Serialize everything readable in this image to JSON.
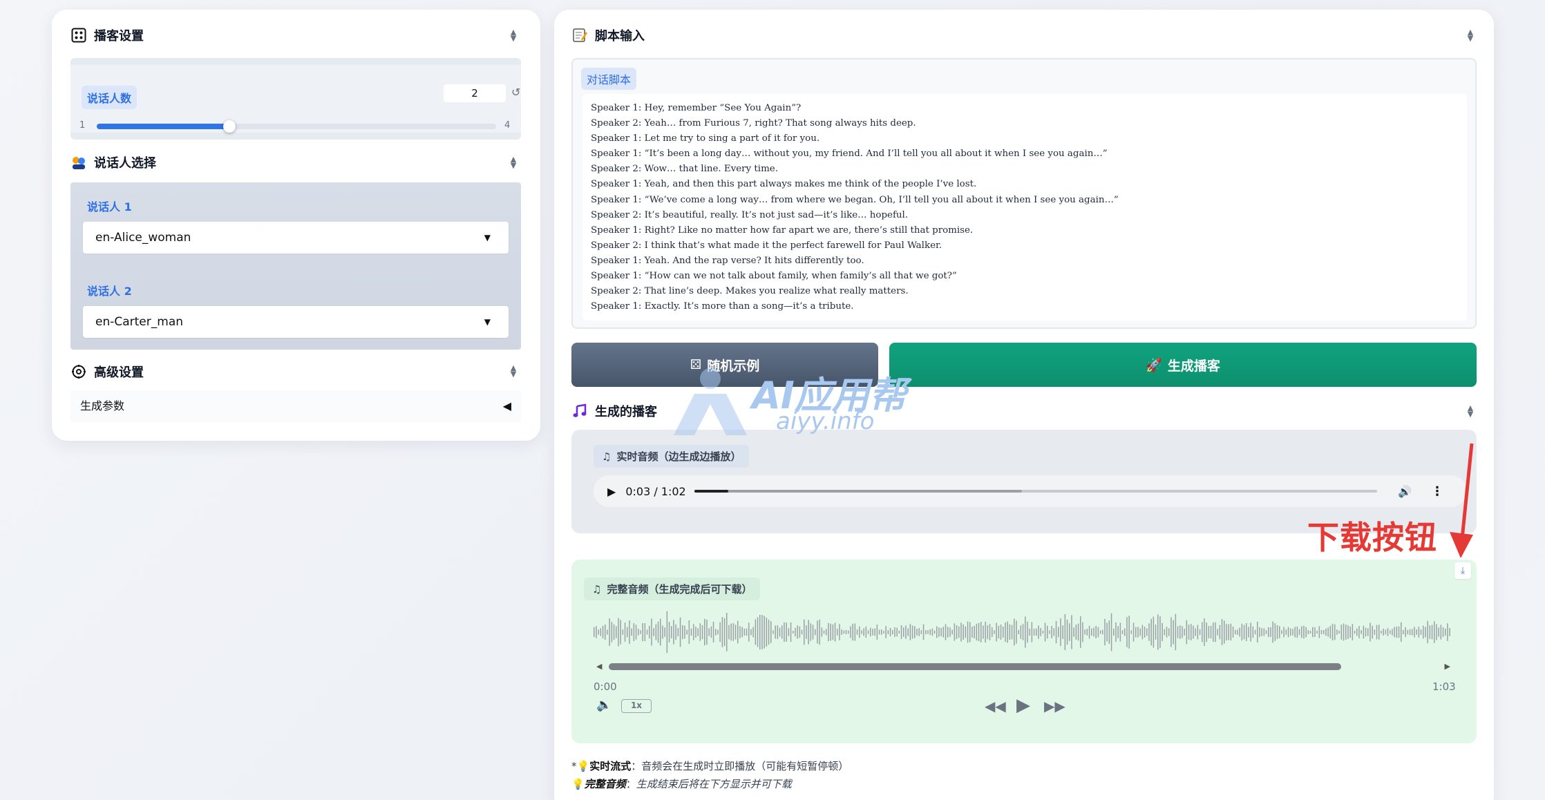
{
  "left": {
    "podcast_settings": {
      "title": "播客设置"
    },
    "speaker_count": {
      "label": "说话人数",
      "value": "2",
      "min": "1",
      "max": "4",
      "fraction": 0.333
    },
    "speaker_select": {
      "title": "说话人选择",
      "speakers": [
        {
          "label": "说话人 1",
          "value": "en-Alice_woman"
        },
        {
          "label": "说话人 2",
          "value": "en-Carter_man"
        }
      ]
    },
    "advanced": {
      "title": "高级设置",
      "params_label": "生成参数"
    }
  },
  "right": {
    "script": {
      "title": "脚本输入",
      "chip": "对话脚本",
      "text": "Speaker 1: Hey, remember “See You Again”?\nSpeaker 2: Yeah… from Furious 7, right? That song always hits deep.\nSpeaker 1: Let me try to sing a part of it for you.\nSpeaker 1: “It’s been a long day… without you, my friend. And I’ll tell you all about it when I see you again…”\nSpeaker 2: Wow… that line. Every time.\nSpeaker 1: Yeah, and then this part always makes me think of the people I’ve lost.\nSpeaker 1: “We’ve come a long way… from where we began. Oh, I’ll tell you all about it when I see you again…”\nSpeaker 2: It’s beautiful, really. It’s not just sad—it’s like… hopeful.\nSpeaker 1: Right? Like no matter how far apart we are, there’s still that promise.\nSpeaker 2: I think that’s what made it the perfect farewell for Paul Walker.\nSpeaker 1: Yeah. And the rap verse? It hits differently too.\nSpeaker 1: “How can we not talk about family, when family’s all that we got?”\nSpeaker 2: That line’s deep. Makes you realize what really matters.\nSpeaker 1: Exactly. It’s more than a song—it’s a tribute."
    },
    "buttons": {
      "random": "随机示例",
      "generate": "生成播客"
    },
    "generated": {
      "title": "生成的播客",
      "live": {
        "chip": "实时音频（边生成边播放）",
        "time": "0:03 / 1:02",
        "played_fraction": 0.05,
        "buffered_fraction": 0.48
      },
      "full": {
        "chip": "完整音频（生成完成后可下载）",
        "start": "0:00",
        "end": "1:03",
        "speed": "1x"
      }
    },
    "notes": [
      {
        "bold": "实时流式",
        "text": "音频会在生成时立即播放（可能有短暂停顿）"
      },
      {
        "bold": "完整音频",
        "text": "生成结束后将在下方显示并可下载"
      }
    ]
  },
  "annotation": {
    "text": "下载按钮",
    "color": "#e53935"
  },
  "watermark": {
    "text": "AI应用帮",
    "sub": "aiyy.info"
  },
  "colors": {
    "accent_blue": "#2f74e9",
    "generate_green": "#10a37f",
    "random_gray": "#64748b",
    "full_audio_bg": "#e3f7e8"
  }
}
